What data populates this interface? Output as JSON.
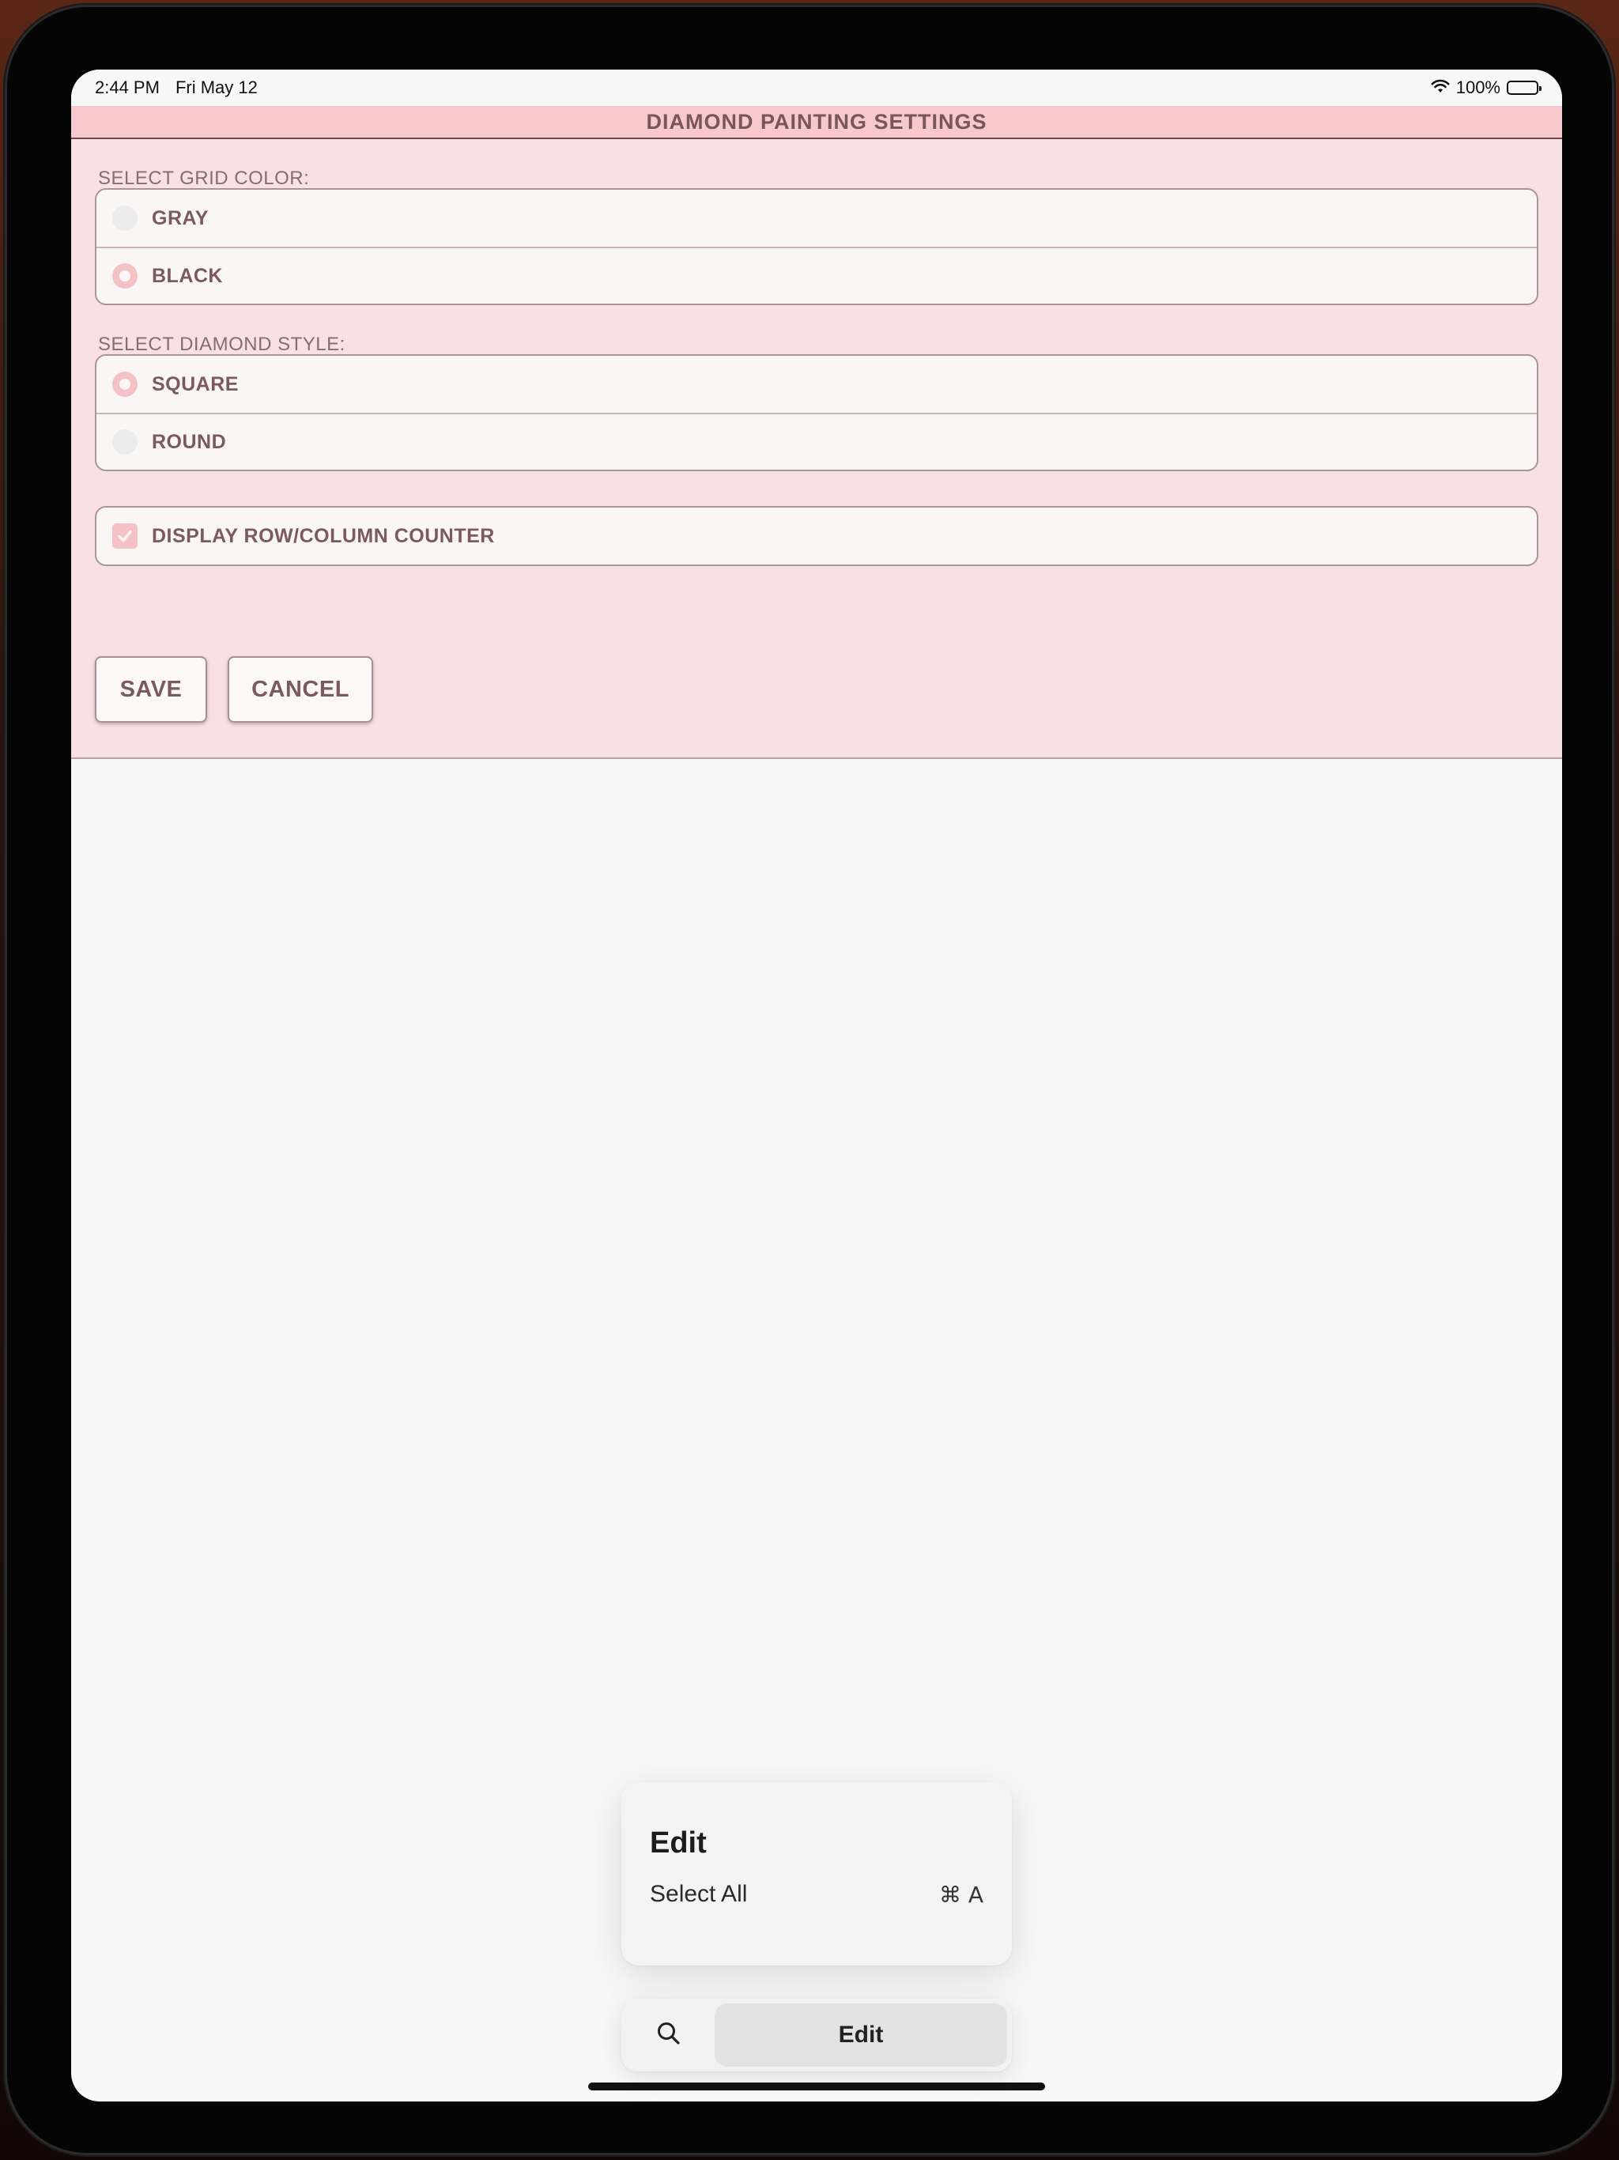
{
  "status_bar": {
    "time": "2:44 PM",
    "date": "Fri May 12",
    "battery": "100%",
    "wifi_icon": "wifi-icon",
    "battery_icon": "battery-icon"
  },
  "settings": {
    "title": "DIAMOND PAINTING SETTINGS",
    "grid_color_label": "SELECT GRID COLOR:",
    "grid_colors": [
      {
        "label": "GRAY",
        "selected": false
      },
      {
        "label": "BLACK",
        "selected": true
      }
    ],
    "diamond_style_label": "SELECT DIAMOND STYLE:",
    "diamond_styles": [
      {
        "label": "SQUARE",
        "selected": true
      },
      {
        "label": "ROUND",
        "selected": false
      }
    ],
    "counter_label": "DISPLAY ROW/COLUMN COUNTER",
    "counter_checked": true,
    "save_label": "SAVE",
    "cancel_label": "CANCEL"
  },
  "edit_menu": {
    "title": "Edit",
    "item_label": "Select All",
    "item_shortcut": "⌘ A"
  },
  "menu_bar": {
    "search_icon": "search-icon",
    "edit_label": "Edit"
  },
  "colors": {
    "title_bg": "#f7c9cc",
    "panel_bg": "#f7e1e2",
    "text": "#7b5a5d",
    "accent": "#f4c2c6"
  }
}
